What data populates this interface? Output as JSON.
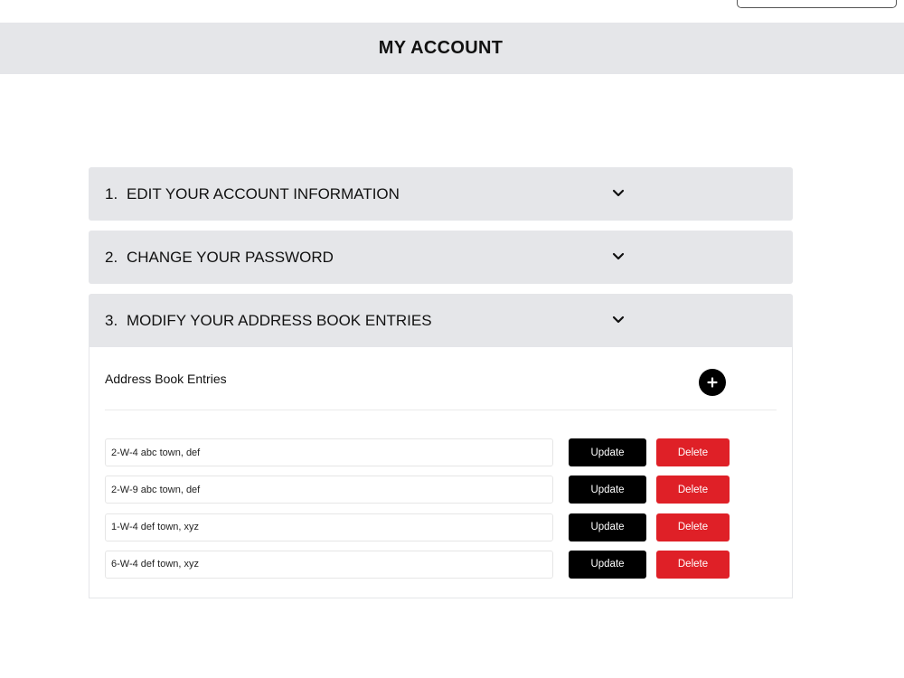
{
  "header": {
    "title": "MY ACCOUNT"
  },
  "accordion": {
    "sections": [
      {
        "number": "1.",
        "title": "EDIT YOUR ACCOUNT INFORMATION",
        "expanded": false
      },
      {
        "number": "2.",
        "title": "CHANGE YOUR PASSWORD",
        "expanded": false
      },
      {
        "number": "3.",
        "title": "MODIFY YOUR ADDRESS BOOK ENTRIES",
        "expanded": true
      }
    ]
  },
  "address_book": {
    "title": "Address Book Entries",
    "add_icon": "plus-icon",
    "entries": [
      {
        "value": "2-W-4 abc town, def",
        "update_label": "Update",
        "delete_label": "Delete"
      },
      {
        "value": "2-W-9 abc town, def",
        "update_label": "Update",
        "delete_label": "Delete"
      },
      {
        "value": "1-W-4 def town, xyz",
        "update_label": "Update",
        "delete_label": "Delete"
      },
      {
        "value": "6-W-4 def town, xyz",
        "update_label": "Update",
        "delete_label": "Delete"
      }
    ]
  },
  "colors": {
    "header_bg": "#e5e6e9",
    "update_button": "#000000",
    "delete_button": "#df2027"
  }
}
